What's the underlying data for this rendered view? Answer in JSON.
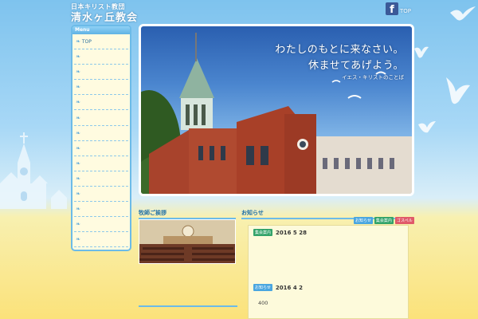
{
  "header": {
    "org": "日本キリスト教団",
    "name": "清水ヶ丘教会",
    "fb_label": "TOP"
  },
  "menu": {
    "title": "Menu",
    "items": [
      "TOP",
      "",
      "",
      "",
      "",
      "",
      "",
      "",
      "",
      "",
      "",
      "",
      "",
      ""
    ]
  },
  "hero": {
    "line1": "わたしのもとに来なさい。",
    "line2": "休ませてあげよう。",
    "attribution": "イエス・キリストのことば"
  },
  "greeting": {
    "heading": "牧師ご挨拶"
  },
  "news": {
    "heading": "お知らせ",
    "tags": [
      {
        "label": "お知らせ",
        "color": "#4aa6e0"
      },
      {
        "label": "集会案内",
        "color": "#33a36a"
      },
      {
        "label": "ゴスペル",
        "color": "#e05a6a"
      }
    ],
    "items": [
      {
        "tag": "集会案内",
        "tag_color": "#33a36a",
        "date": "2016 5 28"
      },
      {
        "tag": "お知らせ",
        "tag_color": "#4aa6e0",
        "date": "2016 4 2"
      }
    ],
    "body_text": "400"
  },
  "colors": {
    "accent": "#6cbbe8",
    "panel": "#fffbe0",
    "facebook": "#3b5998"
  }
}
